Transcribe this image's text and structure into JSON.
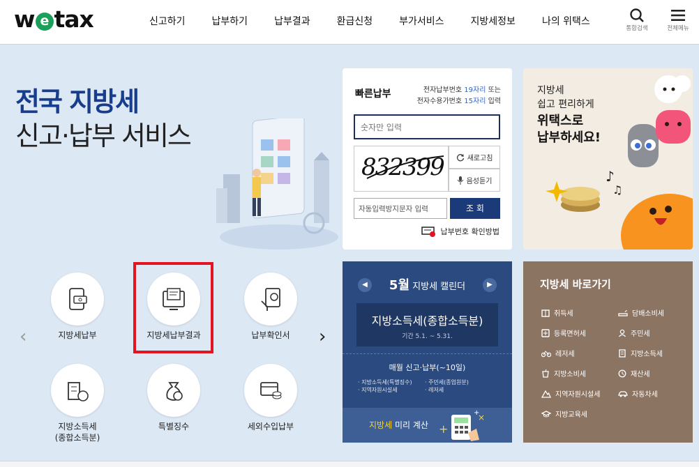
{
  "header": {
    "logo": {
      "before": "w",
      "mark": "e",
      "after": "tax"
    },
    "nav": [
      "신고하기",
      "납부하기",
      "납부결과",
      "환급신청",
      "부가서비스",
      "지방세정보",
      "나의 위택스"
    ],
    "search_label": "통합검색",
    "menu_label": "전체메뉴"
  },
  "hero": {
    "line1": "전국 지방세",
    "line2": "신고·납부 서비스"
  },
  "quick_pay": {
    "title": "빠른납부",
    "desc_line1": {
      "prefix": "전자납부번호 ",
      "highlight": "19자리",
      "suffix": " 또는"
    },
    "desc_line2": {
      "prefix": "전자수용가번호 ",
      "highlight": "15자리",
      "suffix": " 입력"
    },
    "number_placeholder": "숫자만 입력",
    "captcha_text": "832399",
    "refresh_label": "새로고침",
    "audio_label": "음성듣기",
    "captcha_placeholder": "자동입력방지문자 입력",
    "search_label": "조 회",
    "help_label": "납부번호 확인방법"
  },
  "promo": {
    "line1": "지방세",
    "line2": "쉽고 편리하게",
    "line3": "위택스로",
    "line4": "납부하세요!"
  },
  "services": [
    {
      "label": "지방세납부",
      "icon": "mobile-pay-icon"
    },
    {
      "label": "지방세납부결과",
      "icon": "documents-check-icon"
    },
    {
      "label": "납부확인서",
      "icon": "certificate-icon"
    },
    {
      "label": "지방소득세\n(종합소득분)",
      "icon": "building-won-icon"
    },
    {
      "label": "특별징수",
      "icon": "money-bag-icon"
    },
    {
      "label": "세외수입납부",
      "icon": "card-coins-icon"
    }
  ],
  "calendar": {
    "month": "5월",
    "title": "지방세 캘린더",
    "main_tax": "지방소득세(종합소득분)",
    "period": "기간 5.1. ~ 5.31.",
    "monthly_title": "매월 신고·납부(~10일)",
    "items": [
      "· 지방소득세(특별징수)",
      "· 지역자원시설세",
      "· 주민세(종업원분)",
      "· 레저세"
    ],
    "calc_highlight": "지방세",
    "calc_rest": " 미리 계산"
  },
  "shortcuts": {
    "title": "지방세 바로가기",
    "items": [
      {
        "label": "취득세",
        "icon": "building-icon"
      },
      {
        "label": "담배소비세",
        "icon": "cigarette-icon"
      },
      {
        "label": "등록면허세",
        "icon": "license-icon"
      },
      {
        "label": "주민세",
        "icon": "person-icon"
      },
      {
        "label": "레저세",
        "icon": "bicycle-icon"
      },
      {
        "label": "지방소득세",
        "icon": "receipt-icon"
      },
      {
        "label": "지방소비세",
        "icon": "cup-icon"
      },
      {
        "label": "재산세",
        "icon": "property-icon"
      },
      {
        "label": "지역자원시설세",
        "icon": "mountain-icon"
      },
      {
        "label": "자동차세",
        "icon": "car-icon"
      },
      {
        "label": "지방교육세",
        "icon": "graduation-cap-icon"
      }
    ]
  },
  "colors": {
    "navy": "#1b3a7a",
    "blue_text": "#2d63c8",
    "highlight_red": "#e3141f",
    "calendar_bg": "#2b4a7f",
    "shortcut_bg": "#8c7463"
  }
}
